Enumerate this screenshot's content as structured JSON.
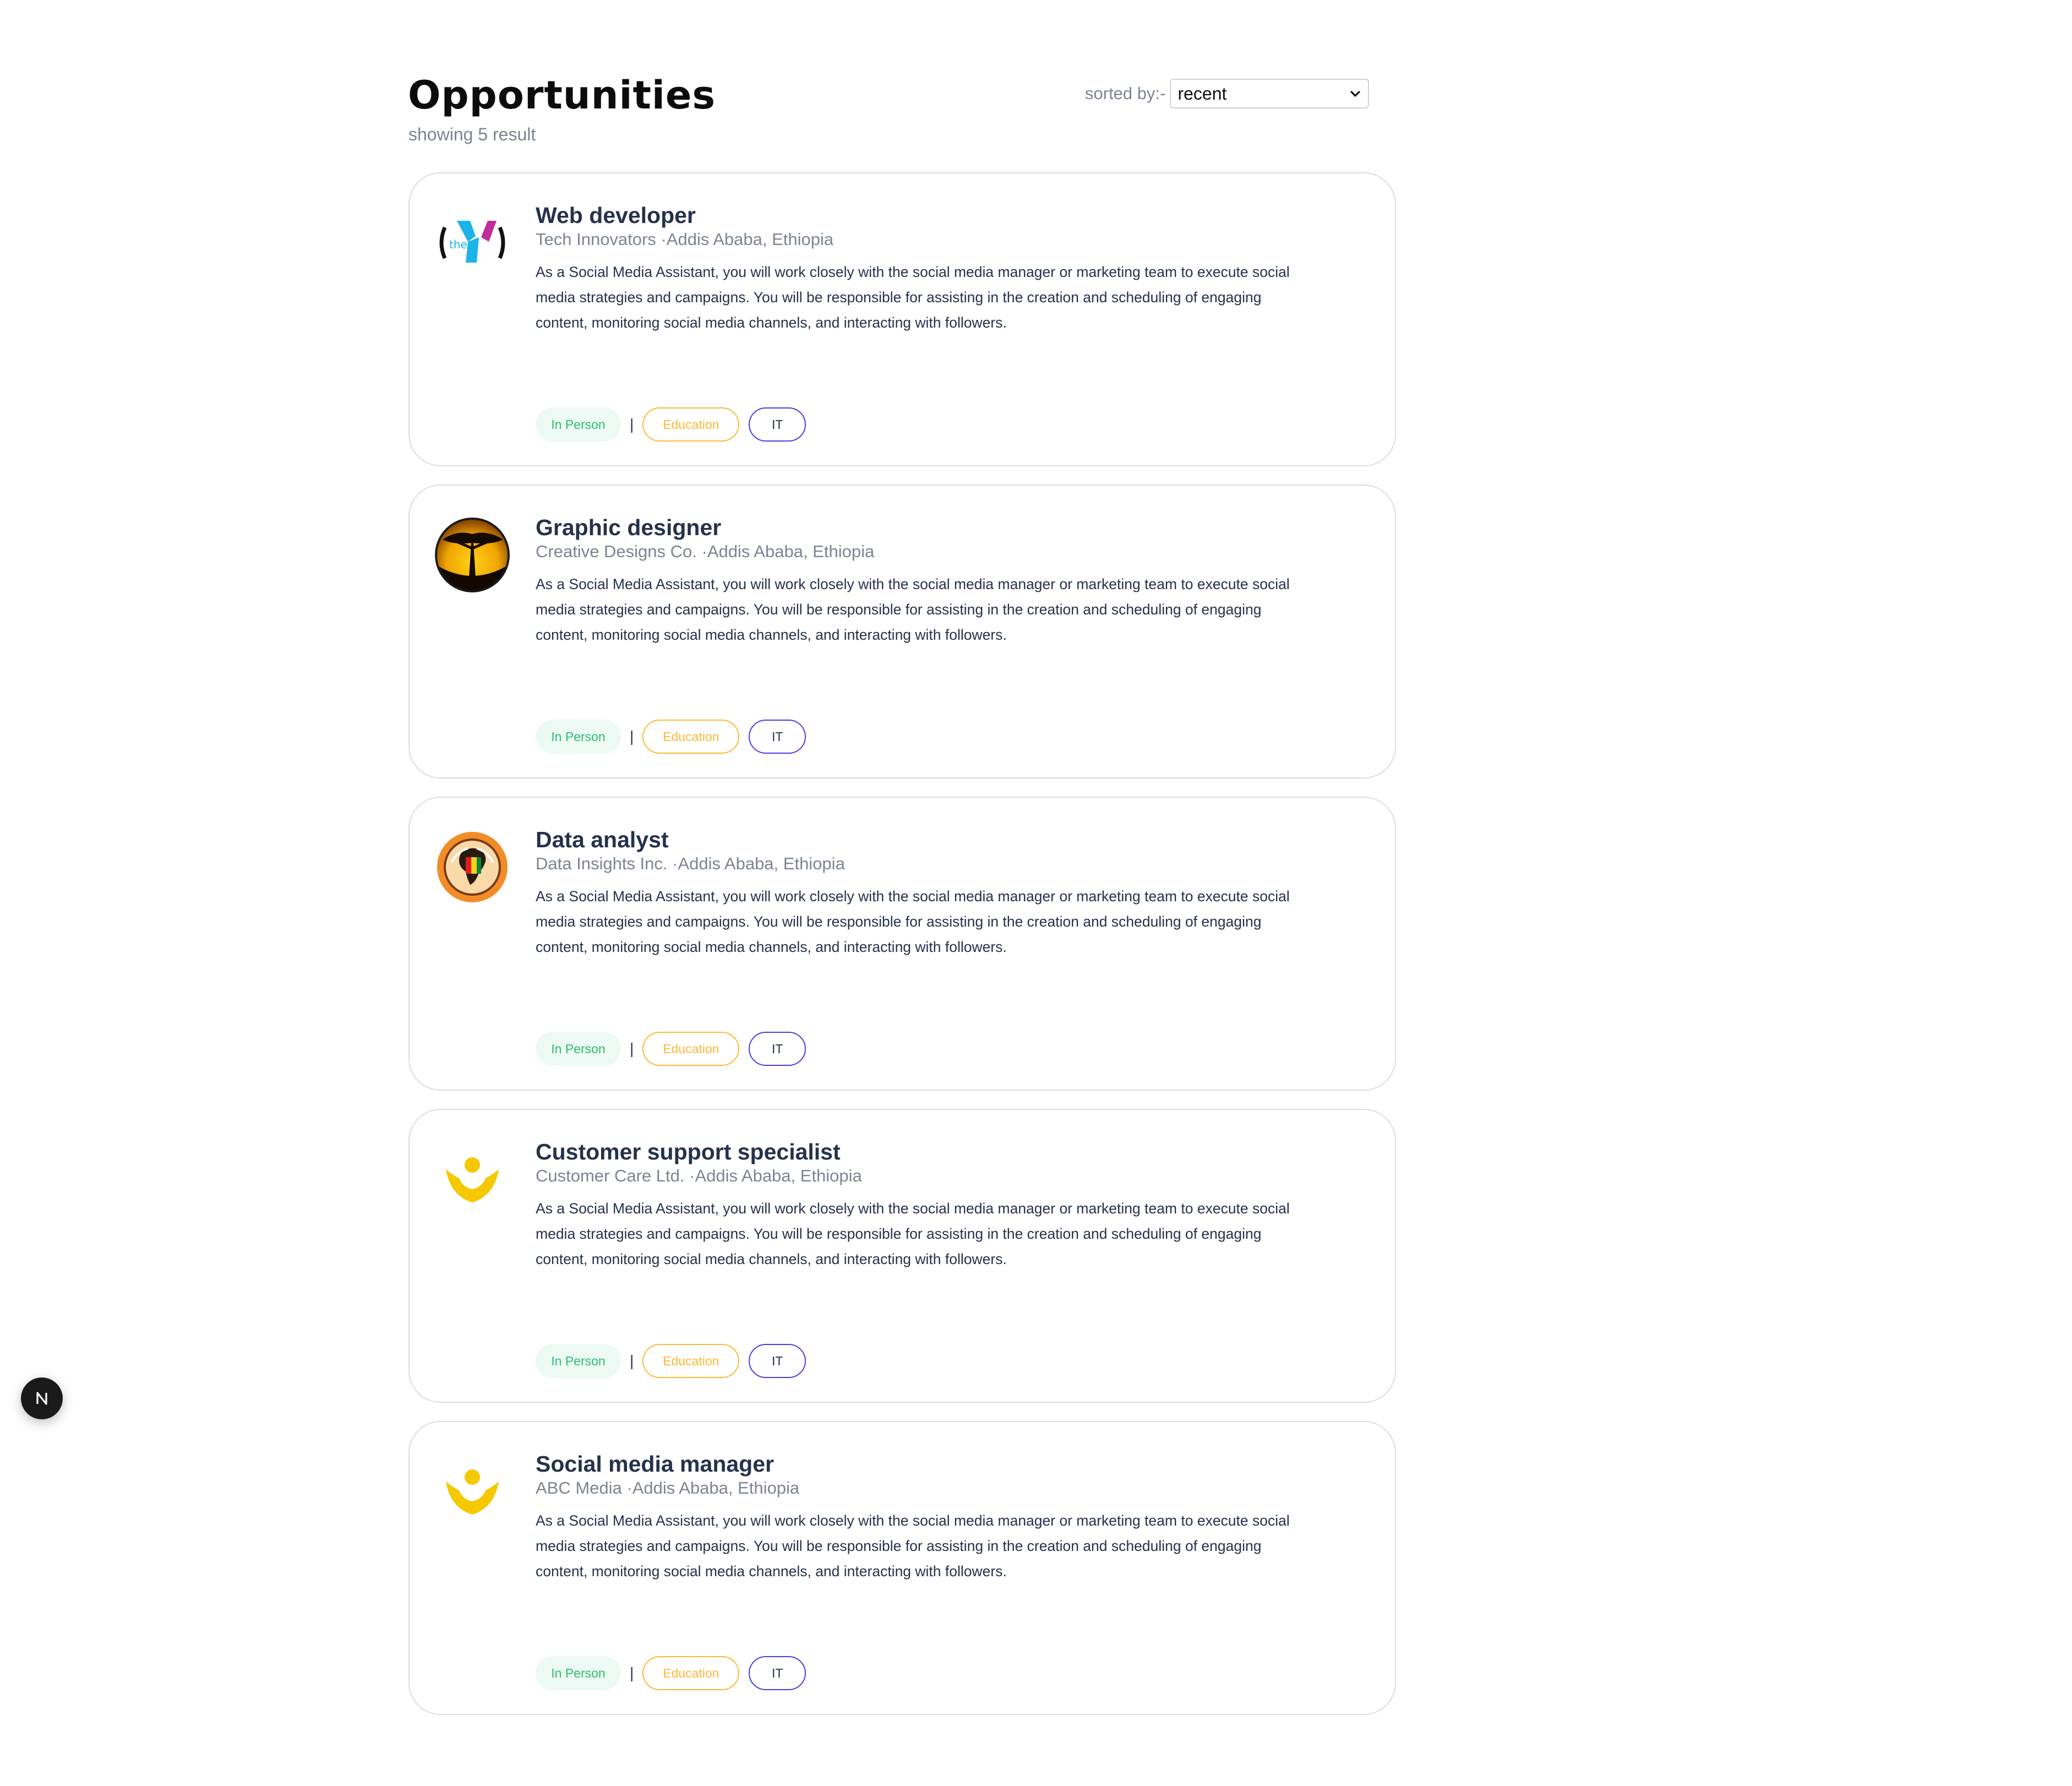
{
  "header": {
    "title": "Opportunities",
    "result_count": "showing 5 result",
    "sort_label": "sorted by:-",
    "sort_value": "recent"
  },
  "jobs": [
    {
      "title": "Web developer",
      "company": "Tech Innovators",
      "location": "·Addis Ababa, Ethiopia",
      "description": "As a Social Media Assistant, you will work closely with the social media manager or marketing team to execute social media strategies and campaigns. You will be responsible for assisting in the creation and scheduling of engaging content, monitoring social media channels, and interacting with followers.",
      "logo": "ymca-logo-icon",
      "tags": {
        "mode": "In Person",
        "separator": "|",
        "category1": "Education",
        "category2": "IT"
      }
    },
    {
      "title": "Graphic designer",
      "company": "Creative Designs Co.",
      "location": "·Addis Ababa, Ethiopia",
      "description": "As a Social Media Assistant, you will work closely with the social media manager or marketing team to execute social media strategies and campaigns. You will be responsible for assisting in the creation and scheduling of engaging content, monitoring social media channels, and interacting with followers.",
      "logo": "acacia-tree-logo-icon",
      "tags": {
        "mode": "In Person",
        "separator": "|",
        "category1": "Education",
        "category2": "IT"
      }
    },
    {
      "title": "Data analyst",
      "company": "Data Insights Inc.",
      "location": "·Addis Ababa, Ethiopia",
      "description": "As a Social Media Assistant, you will work closely with the social media manager or marketing team to execute social media strategies and campaigns. You will be responsible for assisting in the creation and scheduling of engaging content, monitoring social media channels, and interacting with followers.",
      "logo": "africa-badge-logo-icon",
      "tags": {
        "mode": "In Person",
        "separator": "|",
        "category1": "Education",
        "category2": "IT"
      }
    },
    {
      "title": "Customer support specialist",
      "company": "Customer Care Ltd.",
      "location": "·Addis Ababa, Ethiopia",
      "description": "As a Social Media Assistant, you will work closely with the social media manager or marketing team to execute social media strategies and campaigns. You will be responsible for assisting in the creation and scheduling of engaging content, monitoring social media channels, and interacting with followers.",
      "logo": "yellow-figure-logo-icon",
      "tags": {
        "mode": "In Person",
        "separator": "|",
        "category1": "Education",
        "category2": "IT"
      }
    },
    {
      "title": "Social media manager",
      "company": "ABC Media",
      "location": "·Addis Ababa, Ethiopia",
      "description": "As a Social Media Assistant, you will work closely with the social media manager or marketing team to execute social media strategies and campaigns. You will be responsible for assisting in the creation and scheduling of engaging content, monitoring social media channels, and interacting with followers.",
      "logo": "yellow-figure-logo-icon",
      "tags": {
        "mode": "In Person",
        "separator": "|",
        "category1": "Education",
        "category2": "IT"
      }
    }
  ],
  "colors": {
    "title": "#25324b",
    "muted": "#7c8493",
    "in_person": "#2ebc71",
    "education": "#ffb836",
    "it_border": "#4640de"
  },
  "dev_badge": {
    "icon": "nextjs-n-icon"
  }
}
